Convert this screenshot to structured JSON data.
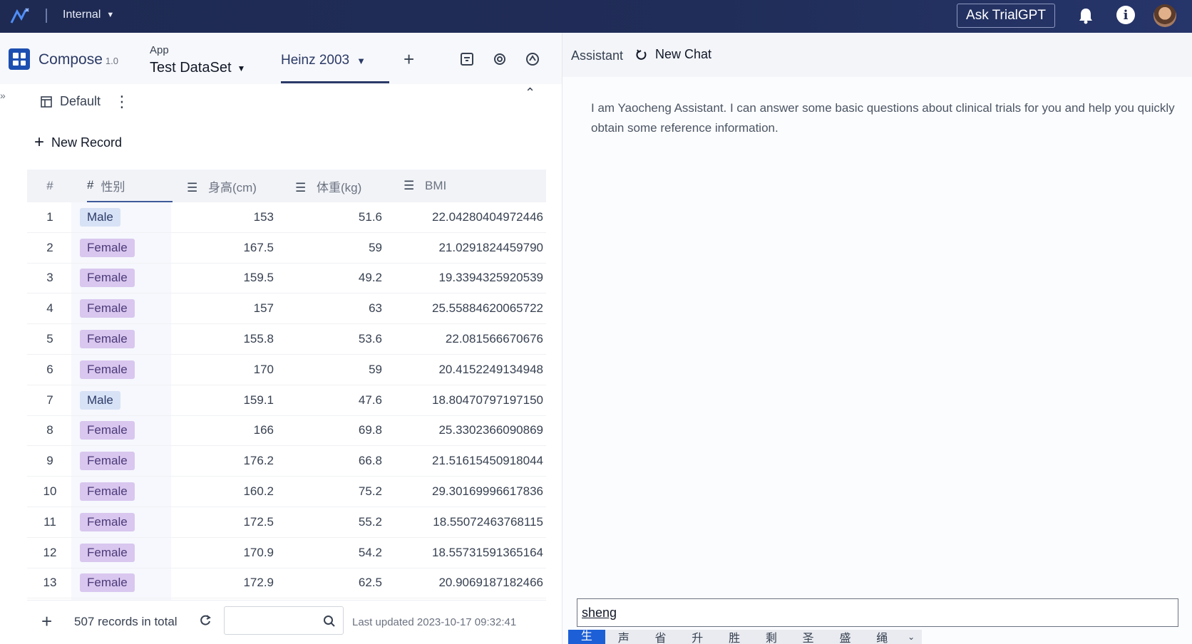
{
  "topbar": {
    "environment": "Internal",
    "ask_button": "Ask TrialGPT"
  },
  "app": {
    "name": "Compose",
    "version": "1.0",
    "app_label": "App",
    "dataset": "Test DataSet",
    "active_tab": "Heinz 2003"
  },
  "view": {
    "name": "Default",
    "new_record": "New Record"
  },
  "table": {
    "columns": [
      "#",
      "性别",
      "身高(cm)",
      "体重(kg)",
      "BMI"
    ],
    "rows": [
      {
        "n": "1",
        "sex": "Male",
        "height": "153",
        "weight": "51.6",
        "bmi": "22.04280404972446"
      },
      {
        "n": "2",
        "sex": "Female",
        "height": "167.5",
        "weight": "59",
        "bmi": "21.0291824459790"
      },
      {
        "n": "3",
        "sex": "Female",
        "height": "159.5",
        "weight": "49.2",
        "bmi": "19.3394325920539"
      },
      {
        "n": "4",
        "sex": "Female",
        "height": "157",
        "weight": "63",
        "bmi": "25.5588462006572​2"
      },
      {
        "n": "5",
        "sex": "Female",
        "height": "155.8",
        "weight": "53.6",
        "bmi": "22.081566670676"
      },
      {
        "n": "6",
        "sex": "Female",
        "height": "170",
        "weight": "59",
        "bmi": "20.4152249134948"
      },
      {
        "n": "7",
        "sex": "Male",
        "height": "159.1",
        "weight": "47.6",
        "bmi": "18.80470797197150"
      },
      {
        "n": "8",
        "sex": "Female",
        "height": "166",
        "weight": "69.8",
        "bmi": "25.3302366090869"
      },
      {
        "n": "9",
        "sex": "Female",
        "height": "176.2",
        "weight": "66.8",
        "bmi": "21.51615450918044"
      },
      {
        "n": "10",
        "sex": "Female",
        "height": "160.2",
        "weight": "75.2",
        "bmi": "29.30169996617836"
      },
      {
        "n": "11",
        "sex": "Female",
        "height": "172.5",
        "weight": "55.2",
        "bmi": "18.55072463768115"
      },
      {
        "n": "12",
        "sex": "Female",
        "height": "170.9",
        "weight": "54.2",
        "bmi": "18.55731591365164"
      },
      {
        "n": "13",
        "sex": "Female",
        "height": "172.9",
        "weight": "62.5",
        "bmi": "20.9069187182466"
      }
    ]
  },
  "footer": {
    "count": "507 records in total",
    "updated": "Last updated 2023-10-17 09:32:41"
  },
  "assistant": {
    "title": "Assistant",
    "new_chat": "New Chat",
    "message": "I am Yaocheng Assistant. I can answer some basic questions about clinical trials for you and help you quickly obtain some reference information.",
    "input_value": "sheng"
  },
  "ime": {
    "candidates": [
      "生",
      "声",
      "省",
      "升",
      "胜",
      "剩",
      "圣",
      "盛",
      "绳"
    ]
  },
  "colors": {
    "topbar": "#1e2a52",
    "tag_male": "#d8e2f6",
    "tag_female": "#d9c7ef",
    "ime_selected": "#1d5fd6"
  }
}
